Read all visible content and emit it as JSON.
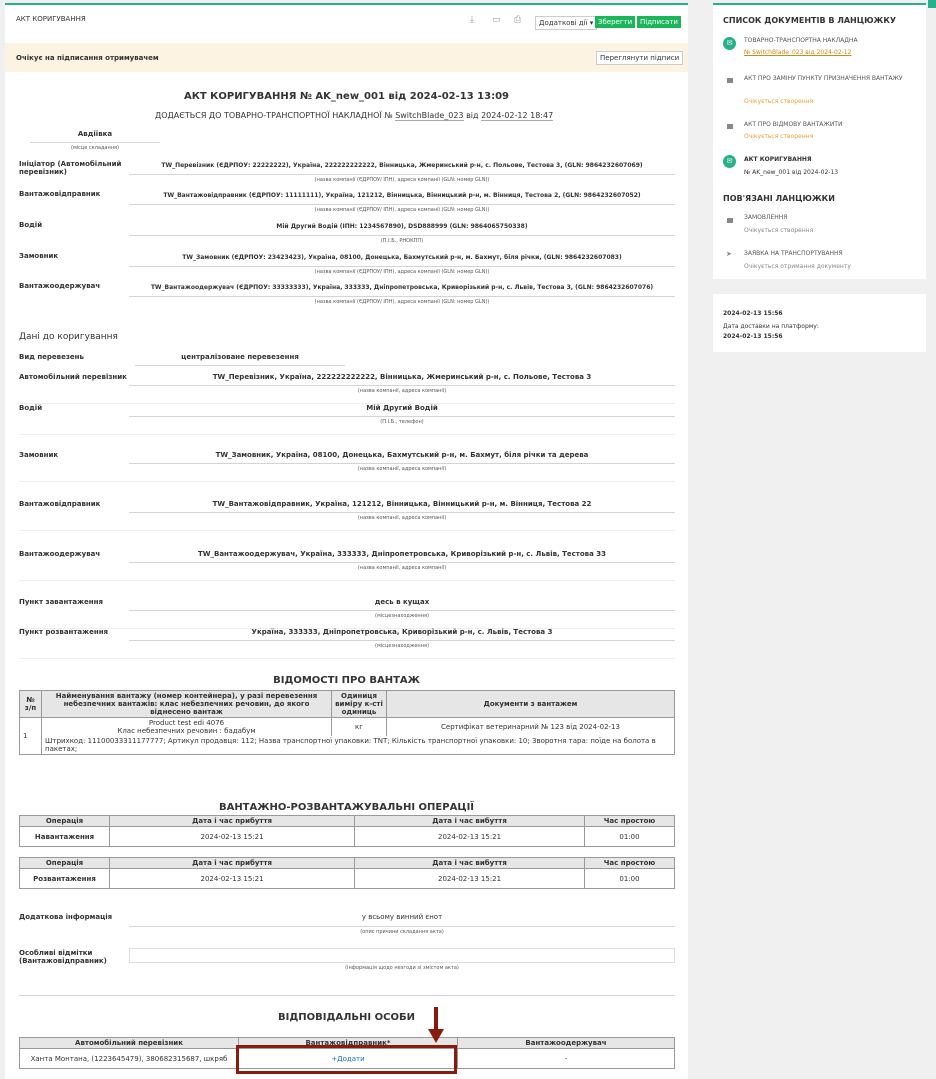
{
  "header": {
    "title": "АКТ КОРИГУВАННЯ",
    "more_actions": "Додаткові дії ▾",
    "save": "Зберегти",
    "sign": "Підписати"
  },
  "status": {
    "text": "Очікує на підписання отримувачем",
    "view_signatures": "Переглянути підписи"
  },
  "doc": {
    "title": "АКТ КОРИГУВАННЯ № AK_new_001 від 2024-02-13 13:09",
    "subtitle_pre": "ДОДАЄТЬСЯ ДО ТОВАРНО-ТРАНСПОРТНОЇ НАКЛАДНОЇ №",
    "ttn_number": "SwitchBlade_023",
    "subtitle_mid": "від",
    "ttn_date": "2024-02-12 18:47",
    "place": "Авдіївка",
    "place_caption": "(місце складання)",
    "parties": [
      {
        "label": "Ініціатор (Автомобільний перевізник)",
        "value": "TW_Перевізник (ЄДРПОУ: 22222222), Україна, 222222222222, Вінницька, Жмеринський р-н, с. Польове, Тестова 3, (GLN: 9864232607069)",
        "caption": "(назва компанії (ЄДРПОУ/ ІПН), адреса компанії (GLN: номер GLN))"
      },
      {
        "label": "Вантажовідправник",
        "value": "TW_Вантажовідправник (ЄДРПОУ: 11111111), Україна, 121212, Вінницька, Вінницький р-н, м. Вінниця, Тестова 2, (GLN: 9864232607052)",
        "caption": "(назва компанії (ЄДРПОУ/ ІПН), адреса компанії (GLN: номер GLN))"
      },
      {
        "label": "Водій",
        "value": "Мій Другий Водій (ІПН: 1234567890), DSD888999 (GLN: 9864065750338)",
        "caption": "(П.І.Б., РНОКПП)"
      },
      {
        "label": "Замовник",
        "value": "TW_Замовник (ЄДРПОУ: 23423423), Україна, 08100, Донецька, Бахмутський р-н, м. Бахмут, біля річки, (GLN: 9864232607083)",
        "caption": "(назва компанії (ЄДРПОУ/ ІПН), адреса компанії (GLN: номер GLN))"
      },
      {
        "label": "Вантажоодержувач",
        "value": "TW_Вантажоодержувач (ЄДРПОУ: 33333333), Україна, 333333, Дніпропетровська, Криворізький р-н, с. Львів, Тестова 3, (GLN: 9864232607076)",
        "caption": "(назва компанії (ЄДРПОУ/ ІПН), адреса компанії (GLN: номер GLN))"
      }
    ],
    "correction_heading": "Дані до коригування",
    "transport_type_label": "Вид перевезень",
    "transport_type_value": "централізоване перевезення",
    "corr": [
      {
        "label": "Автомобільний перевізник",
        "value": "TW_Перевізник, Україна, 222222222222, Вінницька, Жмеринський р-н, с. Польове, Тестова 3",
        "caption": "(назва компанії, адреса компанії)"
      },
      {
        "label": "Водій",
        "value": "Мій Другий Водій",
        "caption": "(П.І.Б., телефон)"
      },
      {
        "label": "Замовник",
        "value": "TW_Замовник, Україна, 08100, Донецька, Бахмутський р-н, м. Бахмут, біля річки та дерева",
        "caption": "(назва компанії, адреса компанії)"
      },
      {
        "label": "Вантажовідправник",
        "value": "TW_Вантажовідправник, Україна, 121212, Вінницька, Вінницький р-н, м. Вінниця, Тестова 22",
        "caption": "(назва компанії, адреса компанії)"
      },
      {
        "label": "Вантажоодержувач",
        "value": "TW_Вантажоодержувач, Україна, 333333, Дніпропетровська, Криворізький р-н, с. Львів, Тестова 33",
        "caption": "(назва компанії, адреса компанії)"
      },
      {
        "label": "Пункт завантаження",
        "value": "десь в кущах",
        "caption": "(місцезнаходження)"
      },
      {
        "label": "Пункт розвантаження",
        "value": "Україна, 333333, Дніпропетровська, Криворізький р-н, с. Львів, Тестова 3",
        "caption": "(місцезнаходження)"
      }
    ],
    "cargo_heading": "ВІДОМОСТІ ПРО ВАНТАЖ",
    "cargo_cols": [
      "№ з/п",
      "Найменування вантажу (номер контейнера), у разі перевезення небезпечних вантажів: клас небезпечних речовин, до якого віднесено вантаж",
      "Одиниця виміру к-сті одиниць",
      "Документи з вантажем"
    ],
    "cargo_row": {
      "num": "1",
      "name": "Product test edi 4076",
      "hazard": "Клас небезпечних речовин : бадабум",
      "unit": "кг",
      "docs": "Сертифікат ветеринарний № 123 від 2024-02-13",
      "details": "Штрихкод: 11100033311177777; Артикул продавця: 112; Назва транспортної упаковки: TNT; Кількість транспортної упаковки: 10; Зворотня тара: поїде на болота в пакетах;"
    },
    "ops_heading": "ВАНТАЖНО-РОЗВАНТАЖУВАЛЬНІ ОПЕРАЦІЇ",
    "ops_cols": [
      "Операція",
      "Дата і час прибуття",
      "Дата і час вибуття",
      "Час простою"
    ],
    "ops": [
      [
        "Навантаження",
        "2024-02-13 15:21",
        "2024-02-13 15:21",
        "01:00"
      ],
      [
        "Розвантаження",
        "2024-02-13 15:21",
        "2024-02-13 15:21",
        "01:00"
      ]
    ],
    "extra_label": "Додаткова інформація",
    "extra_value": "у всьому винний єнот",
    "extra_caption": "(опис причини складання акта)",
    "notes_label": "Особливі відмітки (Вантажовідправник)",
    "notes_caption": "(інформація щодо незгоди зі змістом акта)",
    "resp_heading": "ВІДПОВІДАЛЬНІ ОСОБИ",
    "resp_cols": [
      "Автомобільний перевізник",
      "Вантажовідправник*",
      "Вантажоодержувач"
    ],
    "resp_row": [
      "Ханта Монтана, (1223645479), 380682315687, шкряб",
      "+Додати",
      "-"
    ]
  },
  "side": {
    "chain_title": "СПИСОК ДОКУМЕНТІВ В ЛАНЦЮЖКУ",
    "items": [
      {
        "title": "ТОВАРНО-ТРАНСПОРТНА НАКЛАДНА",
        "sub": "№ SwitchBlade_023 від 2024-02-12"
      },
      {
        "title": "АКТ ПРО ЗАМІНУ ПУНКТУ ПРИЗНАЧЕННЯ ВАНТАЖУ",
        "sub": "Очікується створення"
      },
      {
        "title": "АКТ ПРО ВІДМОВУ ВАНТАЖИТИ",
        "sub": "Очікується створення"
      },
      {
        "title": "АКТ КОРИГУВАННЯ",
        "sub": "№ AK_new_001 від 2024-02-13"
      }
    ],
    "related_title": "ПОВ'ЯЗАНІ ЛАНЦЮЖКИ",
    "related": [
      {
        "title": "ЗАМОВЛЕННЯ",
        "sub": "Очікується створення"
      },
      {
        "title": "ЗАЯВКА НА ТРАНСПОРТУВАННЯ",
        "sub": "Очікується отримання документу"
      }
    ],
    "date_top": "2024-02-13 15:56",
    "delivery_label": "Дата доставки на платформу:",
    "delivery_value": "2024-02-13 15:56"
  }
}
